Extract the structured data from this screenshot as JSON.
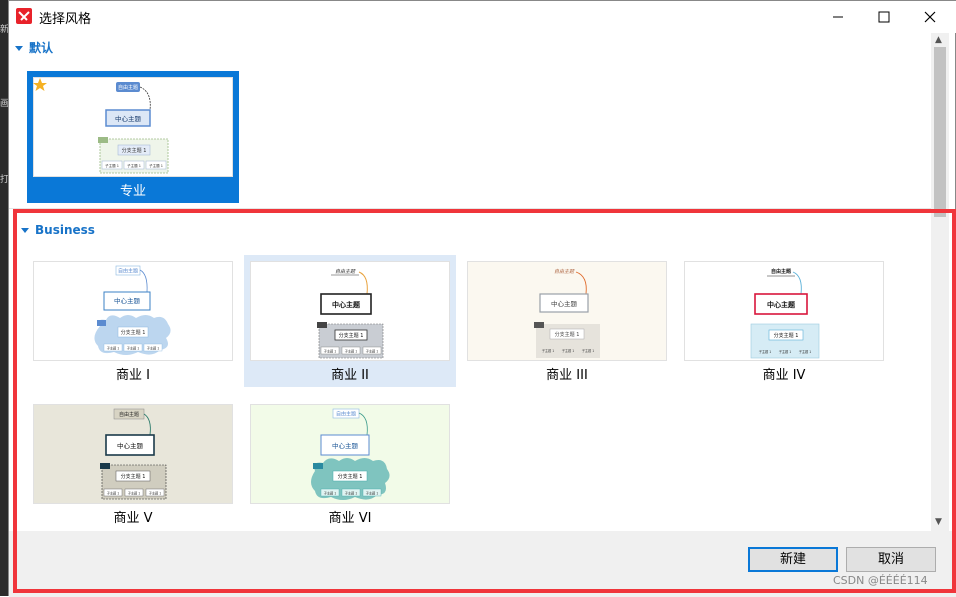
{
  "window": {
    "title": "选择风格"
  },
  "background_fragments": [
    "新",
    "画",
    "打"
  ],
  "sections": [
    {
      "title": "默认",
      "cards": [
        {
          "label": "专业",
          "starred": true,
          "selected": true
        }
      ]
    },
    {
      "title": "Business",
      "cards": [
        {
          "label": "商业 I"
        },
        {
          "label": "商业 II",
          "hovered": true
        },
        {
          "label": "商业 III"
        },
        {
          "label": "商业 IV"
        },
        {
          "label": "商业 V"
        },
        {
          "label": "商业 VI"
        }
      ]
    }
  ],
  "thumbnail_text": {
    "central": "中心主题",
    "floating": "自由主题",
    "main": "分支主题 1",
    "sub": "子主题 1"
  },
  "buttons": {
    "create": "新建",
    "cancel": "取消"
  },
  "watermark": "CSDN @ÉÉÉÉ114",
  "colors": {
    "accent": "#0a78d7",
    "section_title": "#1873c8",
    "highlight_border": "#f0353b"
  }
}
